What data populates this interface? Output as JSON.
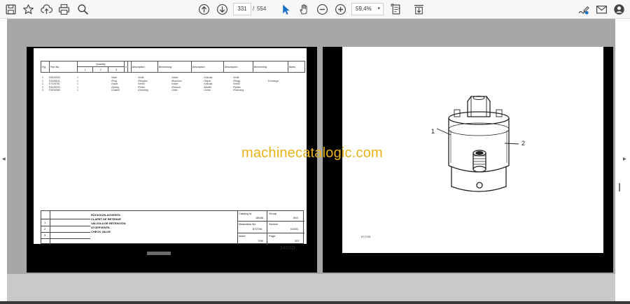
{
  "toolbar": {
    "page_current": "331",
    "page_separator": "/",
    "page_total": "554",
    "zoom": "59,4%",
    "icons": [
      "save-icon",
      "star-icon",
      "upload-icon",
      "print-icon",
      "zoom-magnifier-icon",
      "page-up-icon",
      "page-down-icon",
      "select-cursor-icon",
      "hand-icon",
      "zoom-out-icon",
      "zoom-in-icon",
      "fit-page-icon",
      "download-scroll-icon",
      "sign-icon",
      "mail-icon",
      "account-icon"
    ]
  },
  "watermark": "machinecatalogic.com",
  "left_page": {
    "table_headers": {
      "fig": "Fig.",
      "part_no": "Part No.",
      "quantity": "Quantity",
      "q1": "1",
      "q2": "2",
      "q3": "3",
      "q4": "4",
      "description": "Description",
      "benennung": "Benennung",
      "description_fr": "Description",
      "descripcion": "Descripción",
      "benemning": "Benemning",
      "notes": "Notes"
    },
    "rows": [
      {
        "fig": "1",
        "part": "E3029325",
        "qty": "1",
        "en": "Valve",
        "de": "Ventil",
        "fr": "•Valve",
        "es": "•Válvula",
        "sv": "Ventil",
        "note": ""
      },
      {
        "fig": "1",
        "part": "E3028631",
        "qty": "1",
        "en": "•Plug",
        "de": "•Pfropfen",
        "fr": "•Bouchon",
        "es": "•Tapón",
        "sv": "•Plugg",
        "note": "Exchange"
      },
      {
        "fig": "1",
        "part": "E7026781",
        "qty": "1",
        "en": "•Valve",
        "de": "•Ventil",
        "fr": "•Valve",
        "es": "•Válvula",
        "sv": "•Ventil",
        "note": ""
      },
      {
        "fig": "2",
        "part": "E3029324",
        "qty": "1",
        "en": "•Spring",
        "de": "•Feder",
        "fr": "•Ressort",
        "es": "•Muelle",
        "sv": "•Fjäder",
        "note": ""
      },
      {
        "fig": "3",
        "part": "E3026368",
        "qty": "1",
        "en": "•Gasket",
        "de": "•Dichtung",
        "fr": "•Joint",
        "es": "•Junta",
        "sv": "•Packning",
        "note": ""
      }
    ],
    "title_block": {
      "titles": [
        "RÜCKSCHLAGVENTIL",
        "CLAPET DE RETENUE",
        "VALVULA DE RETENCION",
        "STOPPVENTIL",
        "CHECK VALVE"
      ],
      "rev_numbers": [
        "1",
        "2",
        "3"
      ],
      "catalog_label": "Catalog Id",
      "catalog_value": "18046",
      "group_label": "Group",
      "group_value": "593",
      "illustration_label": "Illustration No",
      "illustration_value": "672706",
      "section_label": "Section",
      "section_value": "01001",
      "issue_label": "Issue",
      "issue_value": "7/96",
      "page_label": "Page",
      "page_value": "307"
    },
    "model": "340SD"
  },
  "right_page": {
    "callout_1": "1",
    "callout_2": "2",
    "image_ref": "672706"
  }
}
